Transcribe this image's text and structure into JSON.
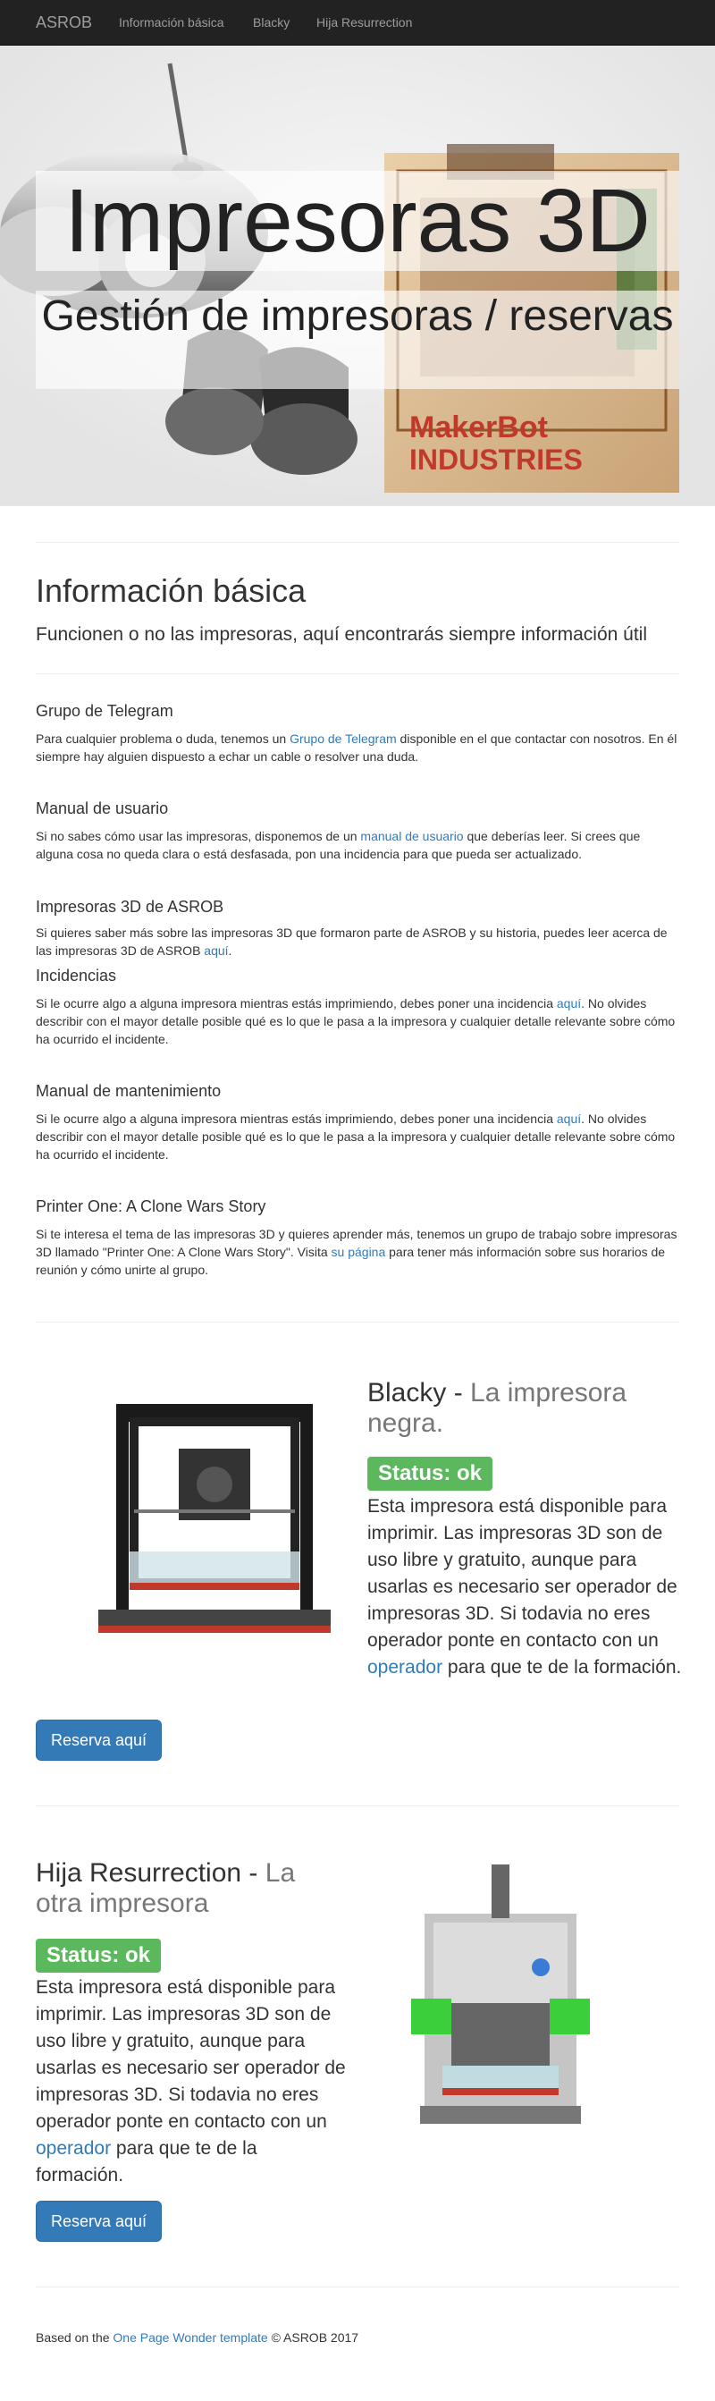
{
  "navbar": {
    "brand": "ASROB",
    "links": [
      "Información básica",
      "Blacky",
      "Hija Resurrection"
    ]
  },
  "hero": {
    "title": "Impresoras 3D",
    "subtitle": "Gestión de impresoras / reservas",
    "image_text": [
      "MakerBot",
      "INDUSTRIES"
    ]
  },
  "info": {
    "title": "Información básica",
    "lead": "Funcionen o no las impresoras, aquí encontrarás siempre información útil",
    "sections": [
      {
        "heading": "Grupo de Telegram",
        "before": "Para cualquier problema o duda, tenemos un ",
        "link": "Grupo de Telegram",
        "after": " disponible en el que contactar con nosotros. En él siempre hay alguien dispuesto a echar un cable o resolver una duda."
      },
      {
        "heading": "Manual de usuario",
        "before": "Si no sabes cómo usar las impresoras, disponemos de un ",
        "link": "manual de usuario",
        "after": " que deberías leer. Si crees que alguna cosa no queda clara o está desfasada, pon una incidencia para que pueda ser actualizado."
      },
      {
        "heading": "Impresoras 3D de ASROB",
        "before": "Si quieres saber más sobre las impresoras 3D que formaron parte de ASROB y su historia, puedes leer acerca de las impresoras 3D de ASROB ",
        "link": "aquí",
        "after": "."
      },
      {
        "heading": "Incidencias",
        "before": "Si le ocurre algo a alguna impresora mientras estás imprimiendo, debes poner una incidencia ",
        "link": "aquí",
        "after": ". No olvides describir con el mayor detalle posible qué es lo que le pasa a la impresora y cualquier detalle relevante sobre cómo ha ocurrido el incidente."
      },
      {
        "heading": "Manual de mantenimiento",
        "before": "Si le ocurre algo a alguna impresora mientras estás imprimiendo, debes poner una incidencia ",
        "link": "aquí",
        "after": ". No olvides describir con el mayor detalle posible qué es lo que le pasa a la impresora y cualquier detalle relevante sobre cómo ha ocurrido el incidente."
      },
      {
        "heading": "Printer One: A Clone Wars Story",
        "before": "Si te interesa el tema de las impresoras 3D y quieres aprender más, tenemos un grupo de trabajo sobre impresoras 3D llamado \"Printer One: A Clone Wars Story\". Visita ",
        "link": "su página",
        "after": " para tener más información sobre sus horarios de reunión y cómo unirte al grupo."
      }
    ]
  },
  "blacky": {
    "name": "Blacky",
    "sep": " - ",
    "tagline": "La impresora negra.",
    "status": "Status: ok",
    "text_before": "Esta impresora está disponible para imprimir. Las impresoras 3D son de uso libre y gratuito, aunque para usarlas es necesario ser operador de impresoras 3D. Si todavia no eres operador ponte en contacto con un ",
    "link": "operador",
    "text_after": " para que te de la formación.",
    "button": "Reserva aquí"
  },
  "hija": {
    "name": "Hija Resurrection",
    "sep": " - ",
    "tagline": "La otra impresora",
    "status": "Status: ok",
    "text_before": "Esta impresora está disponible para imprimir. Las impresoras 3D son de uso libre y gratuito, aunque para usarlas es necesario ser operador de impresoras 3D. Si todavia no eres operador ponte en contacto con un ",
    "link": "operador",
    "text_after": " para que te de la formación.",
    "button": "Reserva aquí"
  },
  "footer": {
    "before": "Based on the ",
    "link": "One Page Wonder template",
    "after": " © ASROB 2017"
  },
  "colors": {
    "navbar_bg": "#222222",
    "link": "#337ab7",
    "success": "#5cb85c",
    "primary_button": "#337ab7",
    "muted": "#777777"
  }
}
